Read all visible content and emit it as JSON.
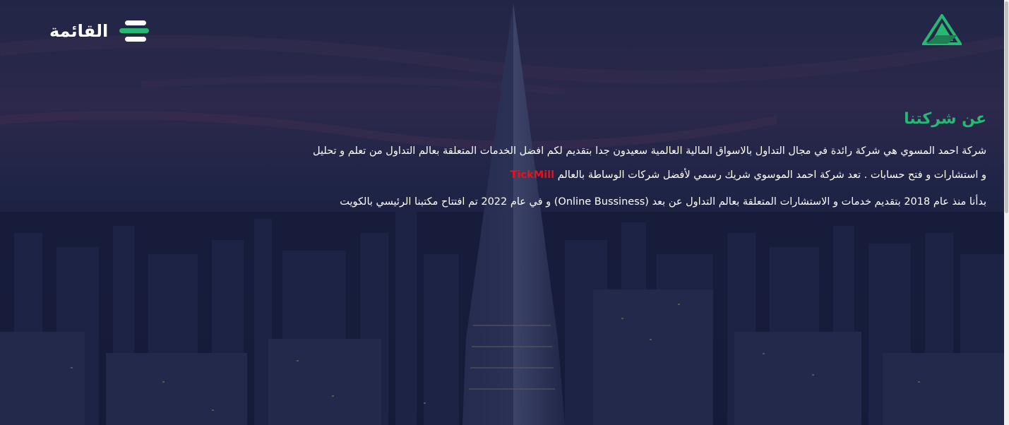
{
  "header": {
    "menu_label": "القائمة",
    "logo_icon": "triangle-logo-icon",
    "menu_icon": "hamburger-menu-icon"
  },
  "about": {
    "title": "عن شركتنا",
    "line1": "شركة احمد المسوي هي شركة رائدة في مجال التداول بالاسواق المالية العالمية سعيدون جدا بتقديم لكم افضل الخدمات المتعلقة بعالم التداول من تعلم و تحليل",
    "line2_before": "و استشارات و فتح حسابات . تعد شركة احمد الموسوي شريك رسمي لأفضل شركات الوساطة بالعالم",
    "line2_brand": "TickMill",
    "line3": "بدأنا منذ عام 2018 بتقديم خدمات و الاستشارات المتعلقة بعالم التداول عن بعد (Online Bussiness) و في عام 2022 تم افتتاح مكتبنا الرئيسي بالكويت"
  },
  "colors": {
    "accent_green": "#27b872",
    "brand_red": "#e3141c",
    "text": "#ffffff",
    "background": "#1f2546"
  }
}
